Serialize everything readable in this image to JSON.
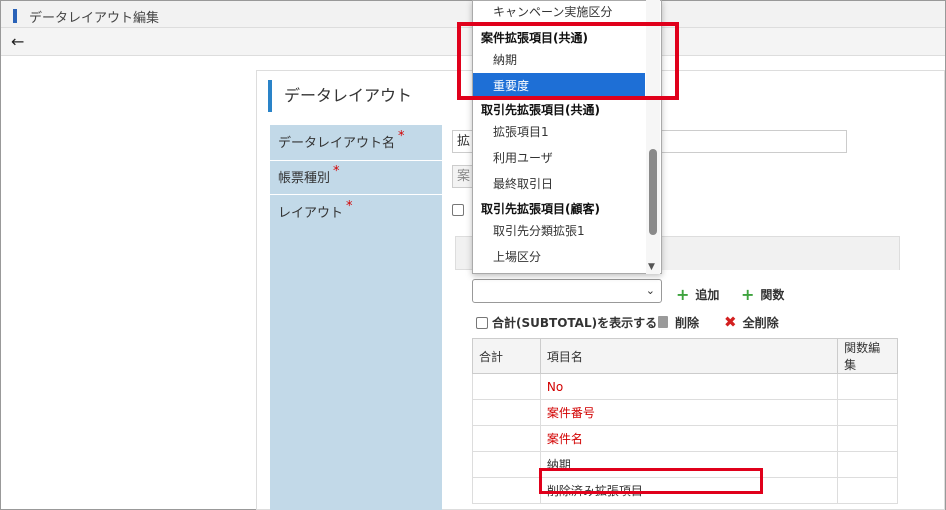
{
  "window": {
    "title": "データレイアウト編集"
  },
  "toolbar": {
    "back_icon": "←"
  },
  "section": {
    "title": "データレイアウト"
  },
  "labels": {
    "layout_name": "データレイアウト名",
    "form_type": "帳票種別",
    "layout": "レイアウト",
    "required_mark": "*"
  },
  "fields": {
    "layout_name_prefix": "拡",
    "form_type_prefix": "案"
  },
  "dropdown": {
    "items": [
      {
        "type": "item",
        "label": "キャンペーン実施区分"
      },
      {
        "type": "group",
        "label": "案件拡張項目(共通)"
      },
      {
        "type": "item",
        "label": "納期"
      },
      {
        "type": "item",
        "label": "重要度",
        "selected": true
      },
      {
        "type": "group",
        "label": "取引先拡張項目(共通)"
      },
      {
        "type": "item",
        "label": "拡張項目1"
      },
      {
        "type": "item",
        "label": "利用ユーザ"
      },
      {
        "type": "item",
        "label": "最終取引日"
      },
      {
        "type": "group",
        "label": "取引先拡張項目(顧客)"
      },
      {
        "type": "item",
        "label": "取引先分類拡張1"
      },
      {
        "type": "item",
        "label": "上場区分"
      }
    ]
  },
  "actions": {
    "add": "追加",
    "function": "関数",
    "subtotal": "合計(SUBTOTAL)を表示する",
    "delete": "削除",
    "delete_all": "全削除"
  },
  "grid": {
    "columns": [
      "合計",
      "項目名",
      "関数編集"
    ],
    "rows": [
      {
        "item": "No",
        "red": true
      },
      {
        "item": "案件番号",
        "red": true
      },
      {
        "item": "案件名",
        "red": true
      },
      {
        "item": "納期",
        "red": false
      },
      {
        "item": "削除済み拡張項目",
        "red": false
      }
    ]
  },
  "colors": {
    "highlight": "#e0001b",
    "accent": "#2a83c8",
    "label_bg": "#c2d9e8",
    "selected_bg": "#1e6fd6"
  }
}
